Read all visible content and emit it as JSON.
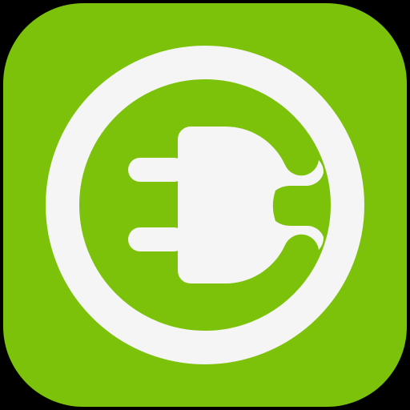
{
  "icon": {
    "name": "ev-charging-plug-icon",
    "colors": {
      "background": "#7DC20A",
      "foreground": "#F5F5F5",
      "canvas": "#000000"
    }
  }
}
